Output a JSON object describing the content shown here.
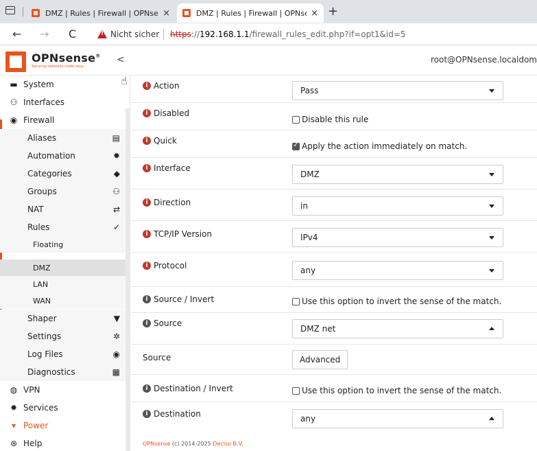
{
  "browser": {
    "tabs": [
      {
        "title": "DMZ | Rules | Firewall | OPNsense",
        "close": "×"
      },
      {
        "title": "DMZ | Rules | Firewall | OPNsense",
        "close": "×"
      }
    ],
    "new_tab": "+",
    "back": "←",
    "forward": "→",
    "reload": "C",
    "security_label": "Nicht sicher",
    "url_scheme": "https",
    "url_sep": "://",
    "url_host": "192.168.1.1",
    "url_path": "/firewall_rules_edit.php?if=opt1&id=5"
  },
  "header": {
    "brand": "OPNsense",
    "reg": "®",
    "tagline": "Securing networks made easy",
    "collapse": "<",
    "user": "root@OPNsense.localdom"
  },
  "sidebar": {
    "items": [
      {
        "label": "System",
        "icon": "▬",
        "icon_name": "server-icon"
      },
      {
        "label": "Interfaces",
        "icon": "⚇",
        "icon_name": "sitemap-icon"
      },
      {
        "label": "Firewall",
        "icon": "◉",
        "icon_name": "fire-icon"
      },
      {
        "label": "Aliases",
        "icon": "▤",
        "icon_name": "list-icon"
      },
      {
        "label": "Automation",
        "icon": "✹",
        "icon_name": "cog-icon"
      },
      {
        "label": "Categories",
        "icon": "◆",
        "icon_name": "tags-icon"
      },
      {
        "label": "Groups",
        "icon": "⚇",
        "icon_name": "sitemap-icon"
      },
      {
        "label": "NAT",
        "icon": "⇄",
        "icon_name": "exchange-icon"
      },
      {
        "label": "Rules",
        "icon": "✓",
        "icon_name": "check-icon"
      },
      {
        "label": "Floating"
      },
      {
        "label": "DMZ"
      },
      {
        "label": "LAN"
      },
      {
        "label": "WAN"
      },
      {
        "label": "Shaper",
        "icon": "▼",
        "icon_name": "filter-icon"
      },
      {
        "label": "Settings",
        "icon": "✲",
        "icon_name": "cogs-icon"
      },
      {
        "label": "Log Files",
        "icon": "◉",
        "icon_name": "eye-icon"
      },
      {
        "label": "Diagnostics",
        "icon": "▦",
        "icon_name": "medkit-icon"
      },
      {
        "label": "VPN",
        "icon": "◍",
        "icon_name": "globe-icon"
      },
      {
        "label": "Services",
        "icon": "✹",
        "icon_name": "cog-icon"
      },
      {
        "label": "Power",
        "icon": "▾",
        "icon_name": "plug-icon"
      },
      {
        "label": "Help",
        "icon": "⊛",
        "icon_name": "support-icon"
      }
    ]
  },
  "form": {
    "action": {
      "label": "Action",
      "value": "Pass"
    },
    "disabled": {
      "label": "Disabled",
      "checkbox_label": "Disable this rule",
      "checked": false
    },
    "quick": {
      "label": "Quick",
      "checkbox_label": "Apply the action immediately on match.",
      "checked": true
    },
    "interface": {
      "label": "Interface",
      "value": "DMZ"
    },
    "direction": {
      "label": "Direction",
      "value": "in"
    },
    "tcpip_version": {
      "label": "TCP/IP Version",
      "value": "IPv4"
    },
    "protocol": {
      "label": "Protocol",
      "value": "any"
    },
    "source_invert": {
      "label": "Source / Invert",
      "checkbox_label": "Use this option to invert the sense of the match.",
      "checked": false
    },
    "source": {
      "label": "Source",
      "value": "DMZ net"
    },
    "source_advanced": {
      "label": "Source",
      "button": "Advanced"
    },
    "destination_invert": {
      "label": "Destination / Invert",
      "checkbox_label": "Use this option to invert the sense of the match.",
      "checked": false
    },
    "destination": {
      "label": "Destination",
      "value": "any"
    }
  },
  "footer": {
    "brand": "OPNsense",
    "text": " (c) 2014-2025 ",
    "company": "Deciso B.V."
  },
  "colors": {
    "accent": "#e8541c",
    "info_required": "#c0392b",
    "info_optional": "#555555"
  }
}
